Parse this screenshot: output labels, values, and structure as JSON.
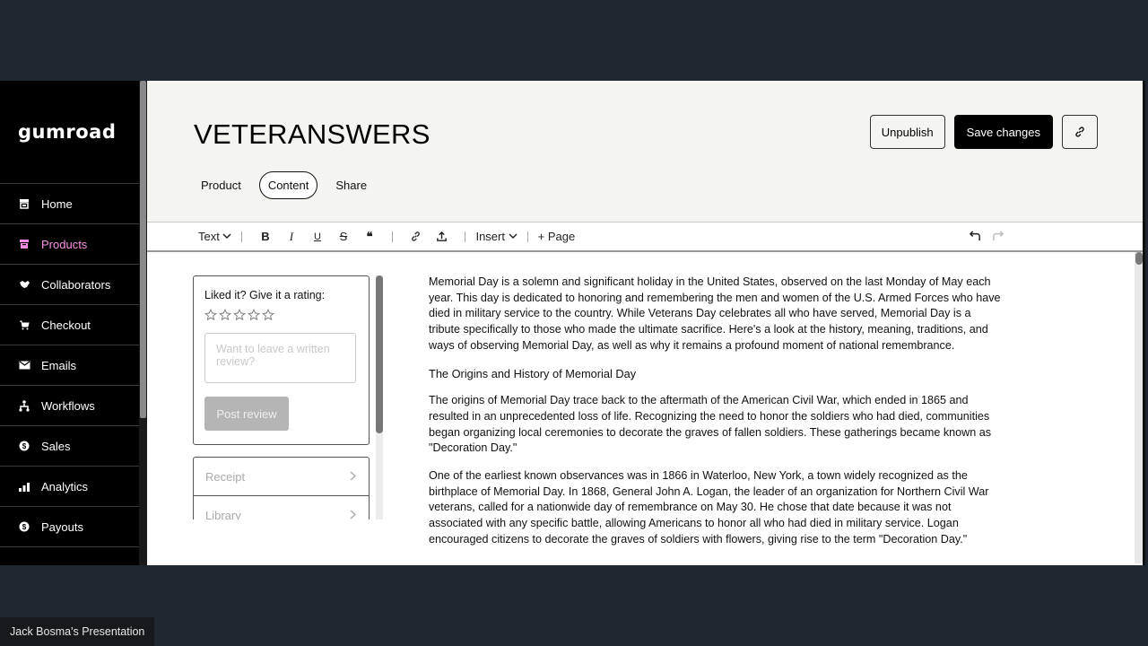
{
  "app": {
    "brand": "gumroad"
  },
  "sidebar": {
    "items": [
      {
        "label": "Home",
        "icon": "store-icon",
        "glyph": "▣",
        "active": false
      },
      {
        "label": "Products",
        "icon": "archive-icon",
        "glyph": "▤",
        "active": true
      },
      {
        "label": "Collaborators",
        "icon": "handshake-icon",
        "glyph": "✋",
        "active": false
      },
      {
        "label": "Checkout",
        "icon": "cart-icon",
        "glyph": "🛒",
        "active": false
      },
      {
        "label": "Emails",
        "icon": "envelope-icon",
        "glyph": "✉",
        "active": false
      },
      {
        "label": "Workflows",
        "icon": "workflow-icon",
        "glyph": "⚲",
        "active": false
      },
      {
        "label": "Sales",
        "icon": "dollar-circle-icon",
        "glyph": "$",
        "active": false
      },
      {
        "label": "Analytics",
        "icon": "bar-chart-icon",
        "glyph": "▂▄▆",
        "active": false
      },
      {
        "label": "Payouts",
        "icon": "dollar-circle-icon",
        "glyph": "$",
        "active": false
      }
    ]
  },
  "header": {
    "title": "VETERANSWERS",
    "unpublish_label": "Unpublish",
    "save_label": "Save changes",
    "link_glyph": "🔗",
    "tabs": [
      {
        "label": "Product",
        "active": false
      },
      {
        "label": "Content",
        "active": true
      },
      {
        "label": "Share",
        "active": false
      }
    ]
  },
  "toolbar": {
    "text_style": "Text",
    "bold": "B",
    "italic": "I",
    "underline": "U",
    "strike": "S",
    "quote": "❝",
    "link": "🔗",
    "upload": "⤒",
    "insert": "Insert",
    "add_page": "+ Page",
    "undo": "↶",
    "redo": "↷"
  },
  "review": {
    "label": "Liked it? Give it a rating:",
    "stars": 5,
    "rating": 0,
    "placeholder": "Want to leave a written review?",
    "post_label": "Post review"
  },
  "links": [
    {
      "label": "Receipt"
    },
    {
      "label": "Library"
    }
  ],
  "document": {
    "paragraphs": [
      "Memorial Day is a solemn and significant holiday in the United States, observed on the last Monday of May each year. This day is dedicated to honoring and remembering the men and women of the U.S. Armed Forces who have died in military service to the country. While Veterans Day celebrates all who have served, Memorial Day is a tribute specifically to those who made the ultimate sacrifice. Here's a look at the history, meaning, traditions, and ways of observing Memorial Day, as well as why it remains a profound moment of national remembrance.",
      "The Origins and History of Memorial Day",
      "The origins of Memorial Day trace back to the aftermath of the American Civil War, which ended in 1865 and resulted in an unprecedented loss of life. Recognizing the need to honor the soldiers who had died, communities began organizing local ceremonies to decorate the graves of fallen soldiers. These gatherings became known as \"Decoration Day.\"",
      "One of the earliest known observances was in 1866 in Waterloo, New York, a town widely recognized as the birthplace of Memorial Day. In 1868, General John A. Logan, the leader of an organization for Northern Civil War veterans, called for a nationwide day of remembrance on May 30. He chose that date because it was not associated with any specific battle, allowing Americans to honor all who had died in military service. Logan encouraged citizens to decorate the graves of soldiers with flowers, giving rise to the term \"Decoration Day.\""
    ]
  },
  "presenter": {
    "label": "Jack Bosma's Presentation"
  },
  "colors": {
    "accent": "#ff90e8",
    "sidebar_bg": "#000000",
    "header_bg": "#f4f4f0",
    "backdrop": "#212730"
  }
}
